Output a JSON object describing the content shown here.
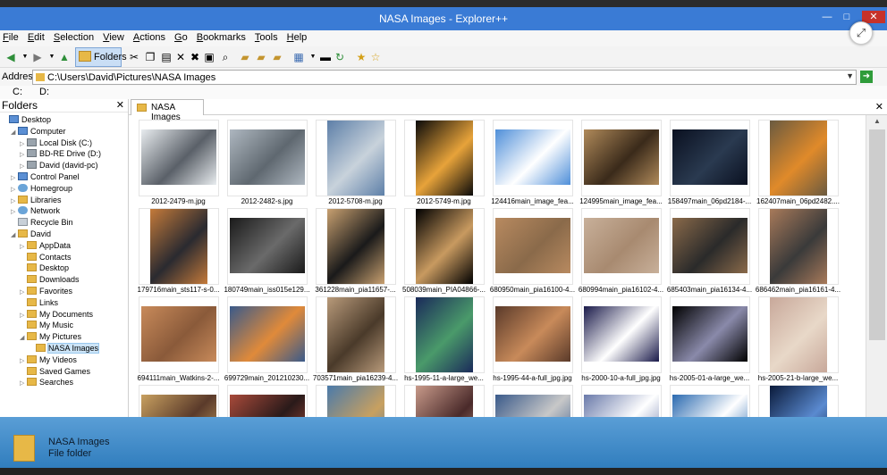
{
  "window": {
    "title": "NASA Images - Explorer++"
  },
  "menu": [
    "File",
    "Edit",
    "Selection",
    "View",
    "Actions",
    "Go",
    "Bookmarks",
    "Tools",
    "Help"
  ],
  "toolbar": {
    "folders_label": "Folders"
  },
  "address": {
    "label": "Address",
    "path": "C:\\Users\\David\\Pictures\\NASA Images"
  },
  "drives": [
    "C:",
    "D:"
  ],
  "folders_pane": {
    "title": "Folders"
  },
  "tree": [
    {
      "label": "Desktop",
      "icon": "desktop-icon",
      "expander": ""
    },
    {
      "label": "Computer",
      "icon": "computer-icon",
      "expander": "◢"
    },
    {
      "label": "Local Disk (C:)",
      "icon": "drive-icon",
      "expander": "▷"
    },
    {
      "label": "BD-RE Drive (D:)",
      "icon": "drive-icon",
      "expander": "▷"
    },
    {
      "label": "David (david-pc)",
      "icon": "network-drive-icon",
      "expander": "▷"
    },
    {
      "label": "Control Panel",
      "icon": "control-panel-icon",
      "expander": "▷"
    },
    {
      "label": "Homegroup",
      "icon": "homegroup-icon",
      "expander": "▷"
    },
    {
      "label": "Libraries",
      "icon": "folder-icon",
      "expander": "▷"
    },
    {
      "label": "Network",
      "icon": "network-icon",
      "expander": "▷"
    },
    {
      "label": "Recycle Bin",
      "icon": "recycle-bin-icon",
      "expander": ""
    },
    {
      "label": "David",
      "icon": "folder-icon",
      "expander": "◢"
    },
    {
      "label": "AppData",
      "icon": "folder-icon",
      "expander": "▷"
    },
    {
      "label": "Contacts",
      "icon": "folder-icon",
      "expander": ""
    },
    {
      "label": "Desktop",
      "icon": "folder-icon",
      "expander": ""
    },
    {
      "label": "Downloads",
      "icon": "folder-icon",
      "expander": ""
    },
    {
      "label": "Favorites",
      "icon": "folder-icon",
      "expander": "▷"
    },
    {
      "label": "Links",
      "icon": "folder-icon",
      "expander": ""
    },
    {
      "label": "My Documents",
      "icon": "folder-icon",
      "expander": "▷"
    },
    {
      "label": "My Music",
      "icon": "folder-icon",
      "expander": ""
    },
    {
      "label": "My Pictures",
      "icon": "folder-icon",
      "expander": "◢"
    },
    {
      "label": "NASA Images",
      "icon": "folder-icon",
      "expander": ""
    },
    {
      "label": "My Videos",
      "icon": "folder-icon",
      "expander": "▷"
    },
    {
      "label": "Saved Games",
      "icon": "folder-icon",
      "expander": ""
    },
    {
      "label": "Searches",
      "icon": "folder-icon",
      "expander": "▷"
    }
  ],
  "tab": {
    "label": "NASA Images"
  },
  "files": [
    {
      "name": "2012-2479-m.jpg",
      "colors": [
        "#e8ecef",
        "#5a6068"
      ]
    },
    {
      "name": "2012-2482-s.jpg",
      "colors": [
        "#aeb7c0",
        "#5f6870"
      ]
    },
    {
      "name": "2012-5708-m.jpg",
      "colors": [
        "#5d7fa8",
        "#c8d2db"
      ]
    },
    {
      "name": "2012-5749-m.jpg",
      "colors": [
        "#0a0a0a",
        "#e7a33a"
      ]
    },
    {
      "name": "124416main_image_fea...",
      "colors": [
        "#4f8fd9",
        "#ffffff"
      ]
    },
    {
      "name": "124995main_image_fea...",
      "colors": [
        "#b08a5a",
        "#3a2a1a"
      ]
    },
    {
      "name": "158497main_06pd2184-...",
      "colors": [
        "#0a1020",
        "#2a3a50"
      ]
    },
    {
      "name": "162407main_06pd2482....",
      "colors": [
        "#6a5a40",
        "#e08a2a"
      ]
    },
    {
      "name": "179716main_sts117-s-0...",
      "colors": [
        "#c47a3a",
        "#2a2a30"
      ]
    },
    {
      "name": "180749main_iss015e129...",
      "colors": [
        "#1a1a1a",
        "#6a6a6a"
      ]
    },
    {
      "name": "361228main_pia11657-...",
      "colors": [
        "#c8a070",
        "#1a1a1a"
      ]
    },
    {
      "name": "508039main_PIA04866-...",
      "colors": [
        "#000000",
        "#c89a60"
      ]
    },
    {
      "name": "680950main_pia16100-4...",
      "colors": [
        "#b88a60",
        "#8a6a4a"
      ]
    },
    {
      "name": "680994main_pia16102-4...",
      "colors": [
        "#c8b09a",
        "#a88a70"
      ]
    },
    {
      "name": "685403main_pia16134-4...",
      "colors": [
        "#8a6a4a",
        "#2a2a2a"
      ]
    },
    {
      "name": "686462main_pia16161-4...",
      "colors": [
        "#a87a5a",
        "#3a3a3a"
      ]
    },
    {
      "name": "694111main_Watkins-2-...",
      "colors": [
        "#c88a5a",
        "#8a5a3a"
      ]
    },
    {
      "name": "699729main_201210230...",
      "colors": [
        "#3a5a8a",
        "#e08a3a"
      ]
    },
    {
      "name": "703571main_pia16239-4...",
      "colors": [
        "#b89a7a",
        "#4a3a2a"
      ]
    },
    {
      "name": "hs-1995-11-a-large_we...",
      "colors": [
        "#1a2a5a",
        "#4a9a6a"
      ]
    },
    {
      "name": "hs-1995-44-a-full_jpg.jpg",
      "colors": [
        "#5a3a2a",
        "#c88a5a"
      ]
    },
    {
      "name": "hs-2000-10-a-full_jpg.jpg",
      "colors": [
        "#1a1a4a",
        "#ffffff"
      ]
    },
    {
      "name": "hs-2005-01-a-large_we...",
      "colors": [
        "#000000",
        "#8a8aaa"
      ]
    },
    {
      "name": "hs-2005-21-b-large_we...",
      "colors": [
        "#c8a89a",
        "#e8d8c8"
      ]
    },
    {
      "name": "",
      "colors": [
        "#c8a060",
        "#5a3a2a"
      ]
    },
    {
      "name": "",
      "colors": [
        "#a84a3a",
        "#2a1a1a"
      ]
    },
    {
      "name": "",
      "colors": [
        "#4a7aaa",
        "#c8a060"
      ]
    },
    {
      "name": "",
      "colors": [
        "#c89a8a",
        "#4a2a2a"
      ]
    },
    {
      "name": "",
      "colors": [
        "#3a5a8a",
        "#c8c8c8"
      ]
    },
    {
      "name": "",
      "colors": [
        "#6a7aaa",
        "#ffffff"
      ]
    },
    {
      "name": "",
      "colors": [
        "#2a6ab0",
        "#ffffff"
      ]
    },
    {
      "name": "",
      "colors": [
        "#0a1a3a",
        "#5a8ad0"
      ]
    }
  ],
  "status": {
    "name": "NASA Images",
    "type": "File folder"
  },
  "colors": {
    "titlebar": "#3a7bd5",
    "statuspanel": "#2b79ba",
    "selection": "#cce4f7"
  }
}
